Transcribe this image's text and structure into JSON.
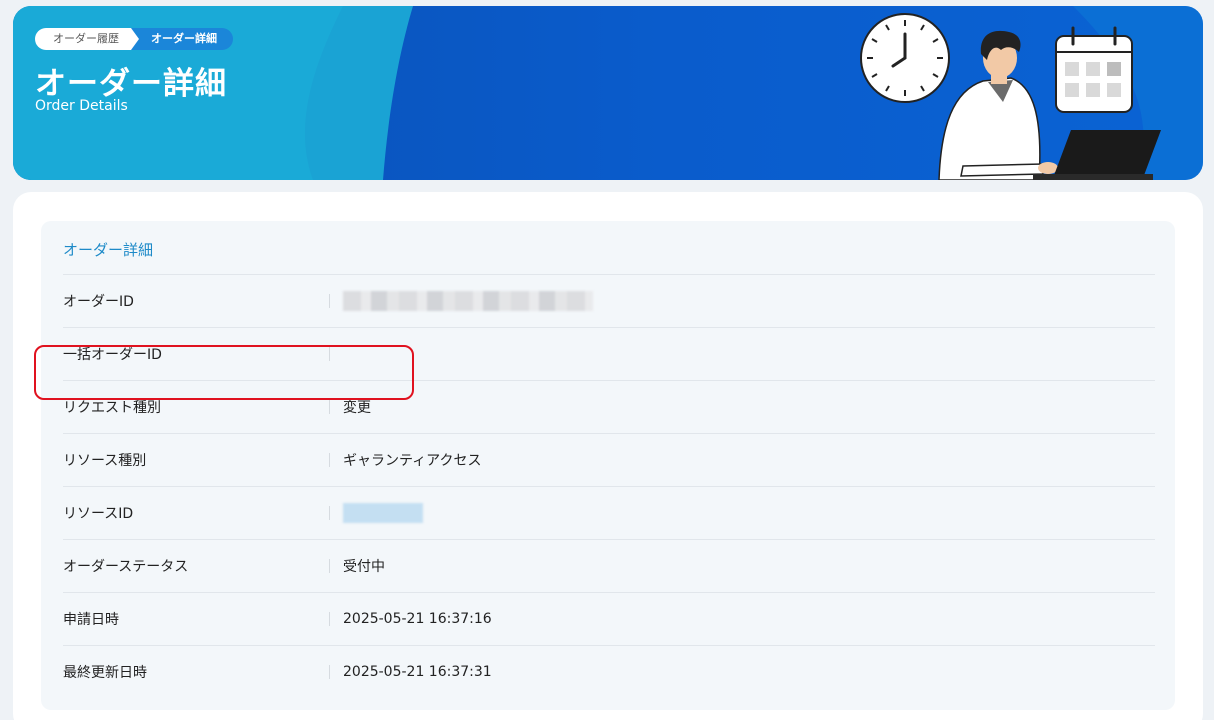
{
  "breadcrumb": {
    "items": [
      {
        "label": "オーダー履歴"
      },
      {
        "label": "オーダー詳細"
      }
    ]
  },
  "header": {
    "title": "オーダー詳細",
    "subtitle": "Order Details"
  },
  "section": {
    "title": "オーダー詳細"
  },
  "rows": [
    {
      "label": "オーダーID",
      "value": ""
    },
    {
      "label": "一括オーダーID",
      "value": ""
    },
    {
      "label": "リクエスト種別",
      "value": "変更"
    },
    {
      "label": "リソース種別",
      "value": "ギャランティアクセス"
    },
    {
      "label": "リソースID",
      "value": ""
    },
    {
      "label": "オーダーステータス",
      "value": "受付中"
    },
    {
      "label": "申請日時",
      "value": "2025-05-21 16:37:16"
    },
    {
      "label": "最終更新日時",
      "value": "2025-05-21 16:37:31"
    }
  ],
  "colors": {
    "accent": "#1d8ac8",
    "hero": "#0a5ccc",
    "highlight": "#e0121f"
  },
  "icons": [
    "clock-icon",
    "calendar-icon",
    "person-illustration",
    "laptop-icon"
  ]
}
